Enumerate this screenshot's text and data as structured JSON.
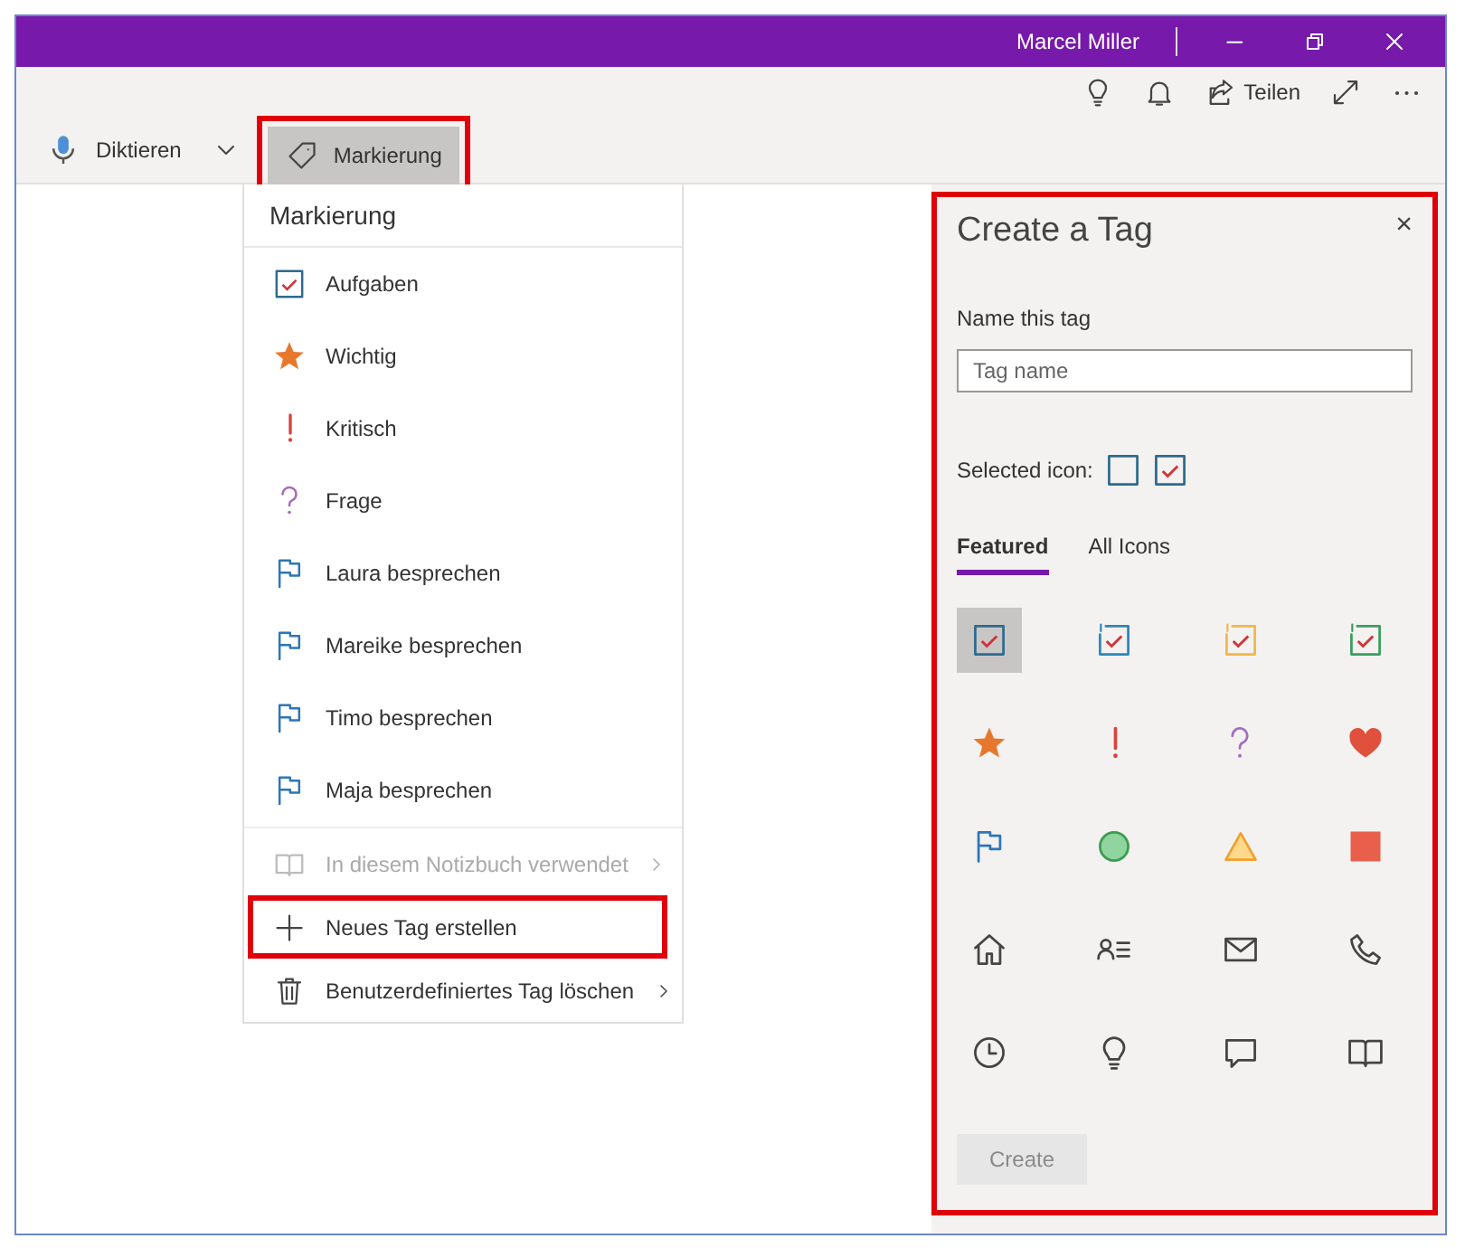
{
  "window": {
    "user": "Marcel Miller"
  },
  "toolbar": {
    "share": "Teilen",
    "dictate": "Diktieren",
    "tag_button": {
      "label": "Markierung",
      "pressed": true,
      "annotated": true
    }
  },
  "menu": {
    "title": "Markierung",
    "items": [
      {
        "kind": "checkbox",
        "label": "Aufgaben",
        "color": "#2e6b8f"
      },
      {
        "kind": "star",
        "label": "Wichtig",
        "color": "#e8772e"
      },
      {
        "kind": "exclamation",
        "label": "Kritisch",
        "color": "#d9433b"
      },
      {
        "kind": "question",
        "label": "Frage",
        "color": "#a66bbe"
      },
      {
        "kind": "flag",
        "label": "Laura besprechen",
        "color": "#2e75b6"
      },
      {
        "kind": "flag",
        "label": "Mareike besprechen",
        "color": "#2e75b6"
      },
      {
        "kind": "flag",
        "label": "Timo besprechen",
        "color": "#2e75b6"
      },
      {
        "kind": "flag",
        "label": "Maja besprechen",
        "color": "#2e75b6"
      }
    ],
    "actions": [
      {
        "kind": "book",
        "label": "In diesem Notizbuch verwendet",
        "disabled": true,
        "submenu": true,
        "annotated": false
      },
      {
        "kind": "plus",
        "label": "Neues Tag erstellen",
        "disabled": false,
        "submenu": false,
        "annotated": true
      },
      {
        "kind": "trash",
        "label": "Benutzerdefiniertes Tag löschen",
        "disabled": false,
        "submenu": true,
        "annotated": false
      }
    ]
  },
  "panel": {
    "title": "Create a Tag",
    "close": "×",
    "annotated": true,
    "name_label": "Name this tag",
    "name_placeholder": "Tag name",
    "selected_icon_label": "Selected icon:",
    "tabs": [
      {
        "label": "Featured",
        "selected": true
      },
      {
        "label": "All Icons",
        "selected": false
      }
    ],
    "icons": [
      {
        "kind": "checkbox",
        "color": "#2e6b8f",
        "selected": true
      },
      {
        "kind": "checkbox-1",
        "color": "#2e86b6",
        "selected": false
      },
      {
        "kind": "checkbox-2",
        "color": "#f0b84a",
        "selected": false
      },
      {
        "kind": "checkbox-3",
        "color": "#3a9d5f",
        "selected": false
      },
      {
        "kind": "star",
        "color": "#e8772e",
        "selected": false
      },
      {
        "kind": "exclamation",
        "color": "#d9433b",
        "selected": false
      },
      {
        "kind": "question",
        "color": "#a66bbe",
        "selected": false
      },
      {
        "kind": "heart",
        "color": "#e0503c",
        "selected": false
      },
      {
        "kind": "flag",
        "color": "#2e75b6",
        "selected": false
      },
      {
        "kind": "circle",
        "color": "#3a9d4f",
        "selected": false
      },
      {
        "kind": "triangle",
        "color": "#f0a030",
        "selected": false
      },
      {
        "kind": "square",
        "color": "#e8604c",
        "selected": false
      },
      {
        "kind": "home",
        "color": "#444444",
        "selected": false
      },
      {
        "kind": "contact",
        "color": "#444444",
        "selected": false
      },
      {
        "kind": "mail",
        "color": "#444444",
        "selected": false
      },
      {
        "kind": "phone",
        "color": "#444444",
        "selected": false
      },
      {
        "kind": "clock",
        "color": "#444444",
        "selected": false
      },
      {
        "kind": "bulb",
        "color": "#444444",
        "selected": false
      },
      {
        "kind": "comment",
        "color": "#444444",
        "selected": false
      },
      {
        "kind": "book",
        "color": "#444444",
        "selected": false
      }
    ],
    "create": {
      "label": "Create",
      "disabled": true
    }
  }
}
